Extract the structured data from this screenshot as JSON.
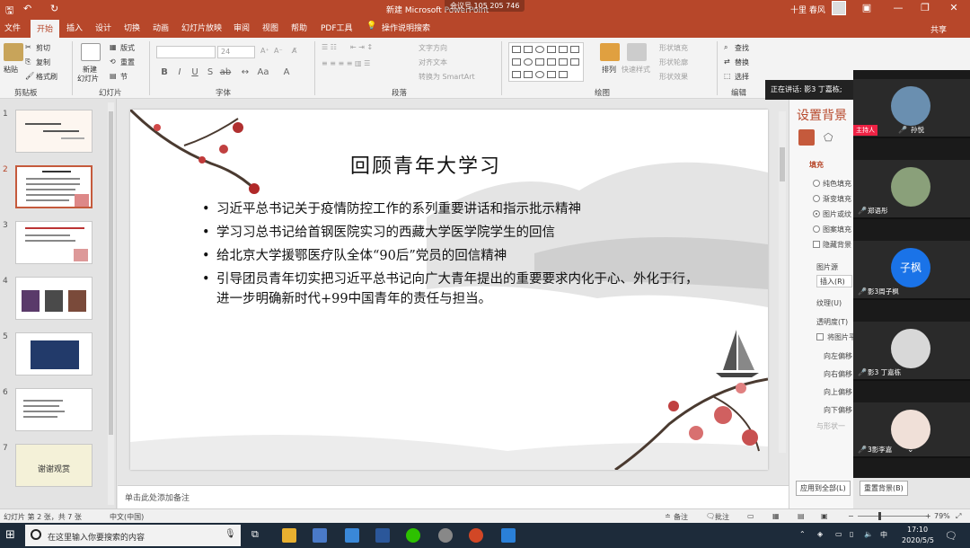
{
  "titlebar": {
    "title": "新建 Microsoft PowerPoint",
    "meeting_id": "会议号 105 205 746",
    "user": "十里 春风",
    "undo": "↶",
    "redo": "↻",
    "save": "🖫"
  },
  "tabs": [
    "文件",
    "开始",
    "插入",
    "设计",
    "切换",
    "动画",
    "幻灯片放映",
    "审阅",
    "视图",
    "帮助",
    "PDF工具",
    "操作说明搜索"
  ],
  "share_label": "共享",
  "ribbon": {
    "clipboard": {
      "paste": "粘贴",
      "cut": "剪切",
      "copy": "复制",
      "format_painter": "格式刷",
      "group": "剪贴板"
    },
    "slides": {
      "new_slide_1": "新建",
      "new_slide_2": "幻灯片",
      "layout": "版式",
      "reset": "重置",
      "section": "节",
      "group": "幻灯片"
    },
    "font": {
      "size": "24",
      "group": "字体"
    },
    "paragraph": {
      "text_direction": "文字方向",
      "align_text": "对齐文本",
      "smartart": "转换为 SmartArt",
      "group": "段落"
    },
    "drawing": {
      "arrange": "排列",
      "quick_styles": "快速样式",
      "shape_fill": "形状填充",
      "shape_outline": "形状轮廓",
      "shape_effects": "形状效果",
      "group": "绘图"
    },
    "editing": {
      "find": "查找",
      "replace": "替换",
      "select": "选择",
      "group": "编辑"
    }
  },
  "slides": [
    {
      "num": "1",
      "text": ""
    },
    {
      "num": "2",
      "text": ""
    },
    {
      "num": "3",
      "text": ""
    },
    {
      "num": "4",
      "text": ""
    },
    {
      "num": "5",
      "text": ""
    },
    {
      "num": "6",
      "text": ""
    },
    {
      "num": "7",
      "text": "谢谢观赏"
    }
  ],
  "slide": {
    "title": "回顾青年大学习",
    "bullets": [
      "习近平总书记关于疫情防控工作的系列重要讲话和指示批示精神",
      "学习习总书记给首钢医院实习的西藏大学医学院学生的回信",
      "给北京大学援鄂医疗队全体“90后”党员的回信精神",
      "引导团员青年切实把习近平总书记向广大青年提出的重要要求内化于心、外化于行，进一步明确新时代+99中国青年的责任与担当。"
    ]
  },
  "notes_placeholder": "单击此处添加备注",
  "format_pane": {
    "title": "设置背景",
    "fill": "填充",
    "options": [
      "纯色填充",
      "渐变填充",
      "图片或纹",
      "图案填充"
    ],
    "hide_bg": "隐藏背景",
    "picture_source": "图片源",
    "insert": "插入(R)",
    "texture": "纹理(U)",
    "transparency": "透明度(T)",
    "tile": "将图片平",
    "offsets": [
      "向左偏移",
      "向右偏移",
      "向上偏移",
      "向下偏移"
    ],
    "rotate": "与形状一",
    "apply_all": "应用到全部(L)",
    "reset_bg": "重置背景(B)"
  },
  "meeting": {
    "speaking": "正在讲话: 影3 丁嘉栋;",
    "participants": [
      {
        "name": "孙悦",
        "host": "主持人",
        "color": "#6a8fb0"
      },
      {
        "name": "郑语彤",
        "color": "#8aa07a"
      },
      {
        "name": "影3周子枫",
        "initials": "子枫",
        "color": "#1a73e8"
      },
      {
        "name": "影3 丁嘉栋",
        "color": "#d8d8d8"
      },
      {
        "name": "3影李嘉",
        "color": "#f0e0d8"
      }
    ]
  },
  "statusbar": {
    "slide_of": "幻灯片 第 2 张，共 7 张",
    "language": "中文(中国)",
    "notes": "备注",
    "comments": "批注",
    "zoom": "79%"
  },
  "taskbar": {
    "search_placeholder": "在这里输入你要搜索的内容",
    "time": "17:10",
    "date": "2020/5/5",
    "ime": "中"
  }
}
